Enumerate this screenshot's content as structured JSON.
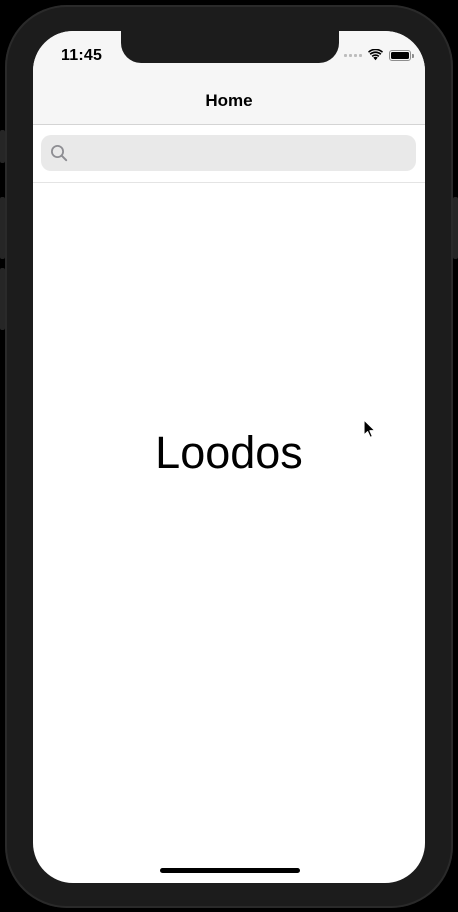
{
  "status_bar": {
    "time": "11:45"
  },
  "nav": {
    "title": "Home"
  },
  "search": {
    "placeholder": "",
    "value": ""
  },
  "main": {
    "label": "Loodos"
  },
  "colors": {
    "device_frame": "#1c1c1c",
    "nav_background": "#f6f6f6",
    "search_field": "#e9e9e9",
    "text": "#000000"
  },
  "icons": [
    "search-icon",
    "wifi-icon",
    "battery-icon",
    "cellular-signal-icon",
    "mouse-cursor-icon"
  ]
}
